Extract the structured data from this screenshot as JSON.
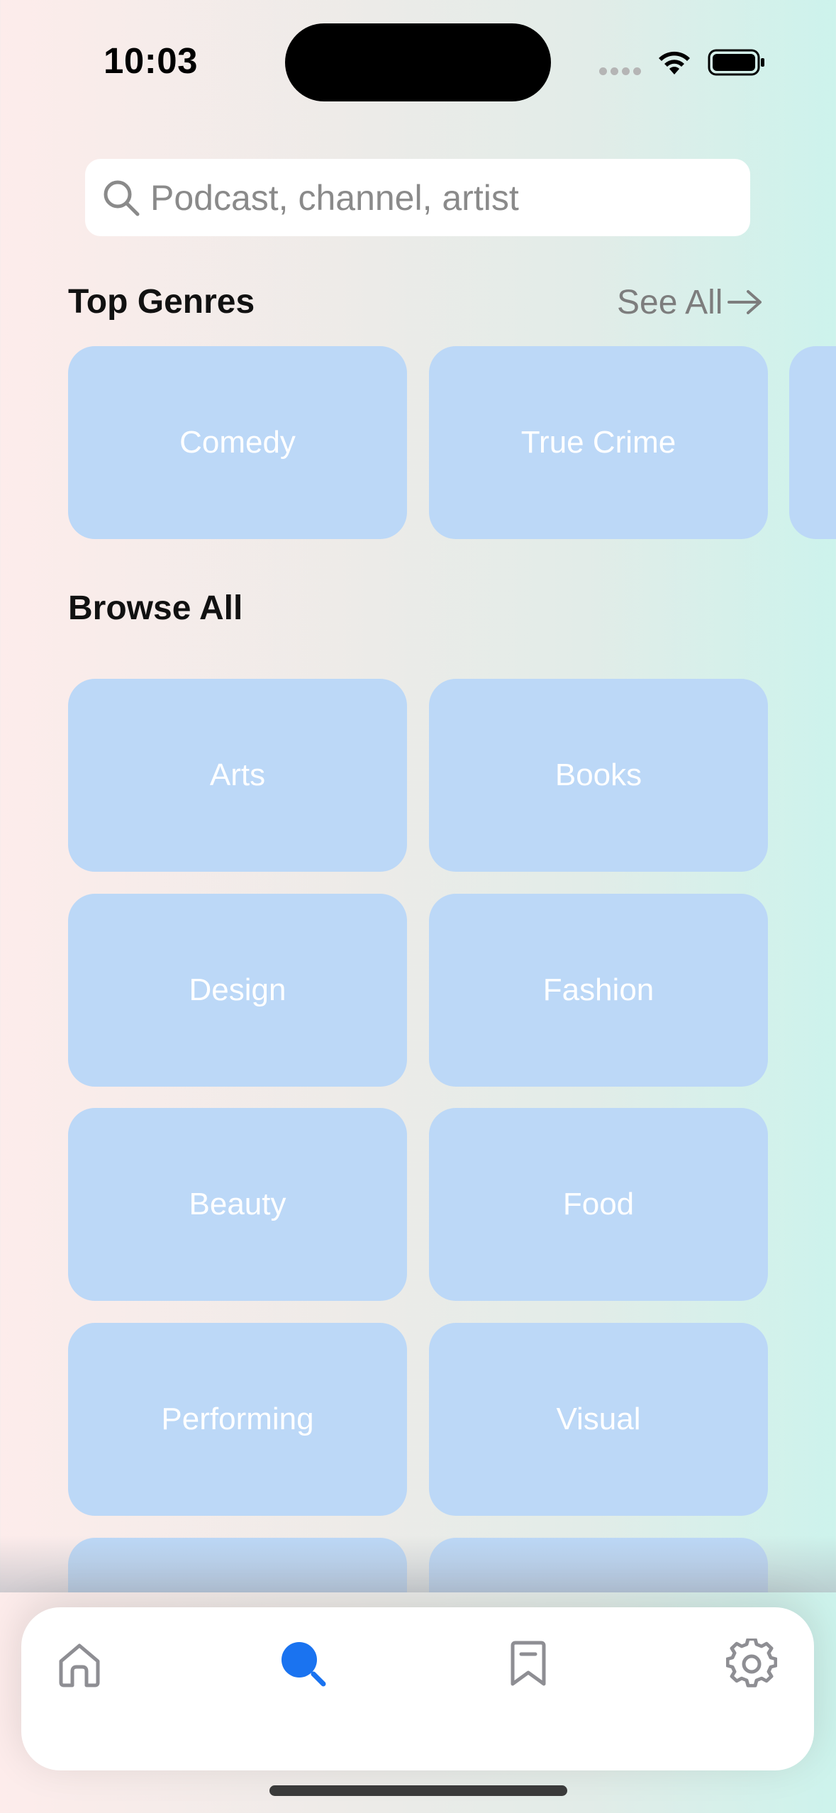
{
  "status_bar": {
    "time": "10:03"
  },
  "search": {
    "placeholder": "Podcast, channel, artist",
    "icon": "search-icon"
  },
  "top_genres": {
    "title": "Top Genres",
    "see_all_label": "See All",
    "items": [
      {
        "label": "Comedy"
      },
      {
        "label": "True Crime"
      }
    ]
  },
  "browse_all": {
    "title": "Browse All",
    "items": [
      {
        "label": "Arts"
      },
      {
        "label": "Books"
      },
      {
        "label": "Design"
      },
      {
        "label": "Fashion"
      },
      {
        "label": "Beauty"
      },
      {
        "label": "Food"
      },
      {
        "label": "Performing"
      },
      {
        "label": "Visual"
      }
    ]
  },
  "tab_bar": {
    "tabs": [
      {
        "name": "home",
        "icon": "home-icon",
        "active": false
      },
      {
        "name": "search",
        "icon": "search-icon",
        "active": true
      },
      {
        "name": "saved",
        "icon": "bookmark-icon",
        "active": false
      },
      {
        "name": "settings",
        "icon": "gear-icon",
        "active": false
      }
    ]
  },
  "colors": {
    "tile": "#bcd8f7",
    "accent": "#1a73f0",
    "inactive_icon": "#8e8e93"
  }
}
